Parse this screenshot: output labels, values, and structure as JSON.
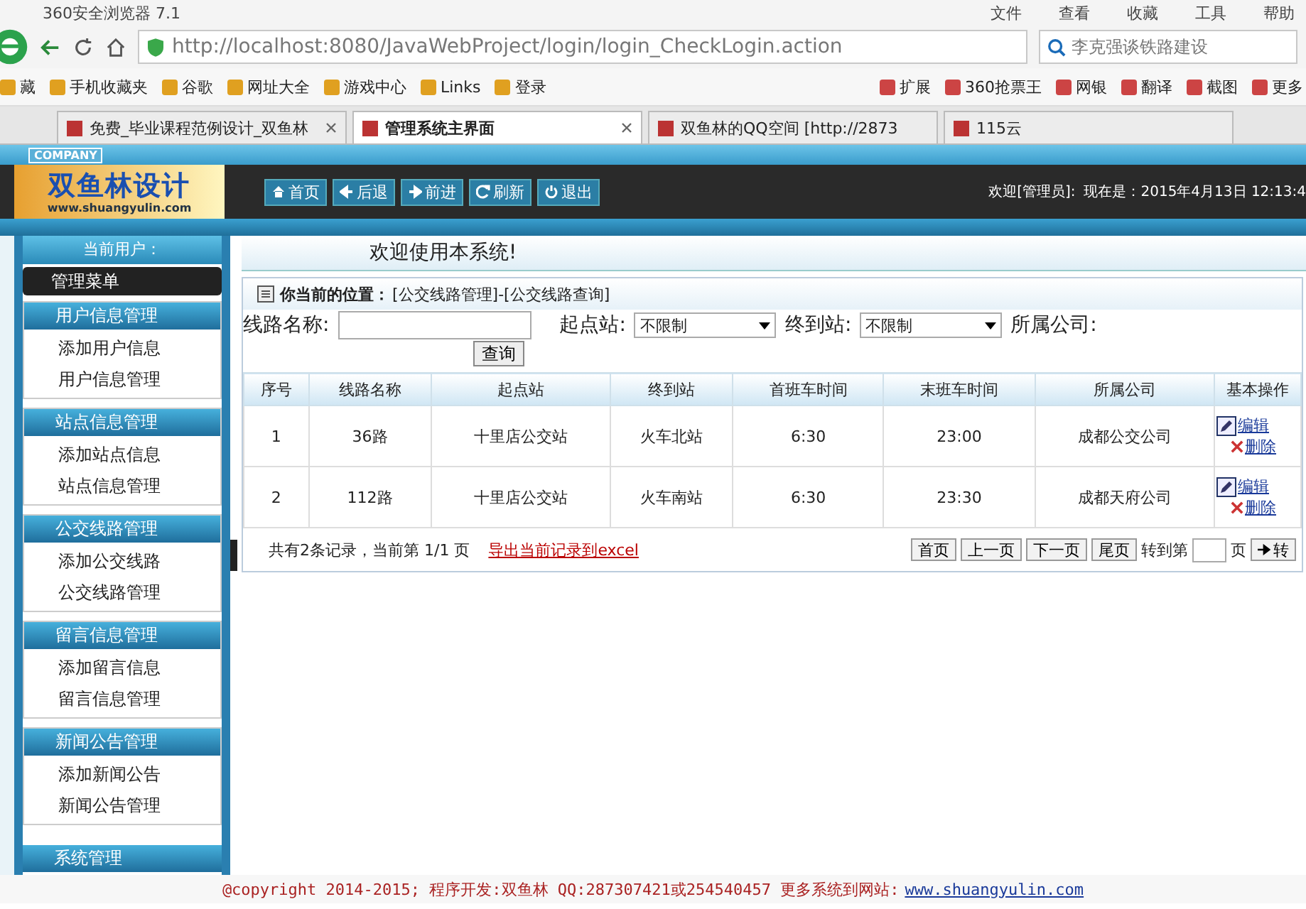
{
  "browser": {
    "title": "360安全浏览器 7.1",
    "menu": [
      "文件",
      "查看",
      "收藏",
      "工具",
      "帮助"
    ],
    "url": "http://localhost:8080/JavaWebProject/login/login_CheckLogin.action",
    "search": "李克强谈铁路建设",
    "bookmarks_left": [
      "藏",
      "手机收藏夹",
      "谷歌",
      "网址大全",
      "游戏中心",
      "Links",
      "登录"
    ],
    "bookmarks_right": [
      "扩展",
      "360抢票王",
      "网银",
      "翻译",
      "截图",
      "更多"
    ],
    "tabs": [
      {
        "label": "免费_毕业课程范例设计_双鱼林",
        "selected": false,
        "closable": true
      },
      {
        "label": "管理系统主界面",
        "selected": true,
        "closable": true
      },
      {
        "label": "双鱼林的QQ空间 [http://2873",
        "selected": false,
        "closable": false
      },
      {
        "label": "115云",
        "selected": false,
        "closable": false
      }
    ]
  },
  "header": {
    "badge": "COMPANY",
    "logo_text": "双鱼林设计",
    "logo_url": "www.shuangyulin.com",
    "nav": [
      {
        "label": "首页"
      },
      {
        "label": "后退"
      },
      {
        "label": "前进"
      },
      {
        "label": "刷新"
      },
      {
        "label": "退出"
      }
    ],
    "welcome": "欢迎[管理员]:",
    "clock": "现在是：2015年4月13日 12:13:4"
  },
  "sidebar": {
    "user_label": "当前用户：",
    "menu_title": "管理菜单",
    "groups": [
      {
        "title": "用户信息管理",
        "items": [
          "添加用户信息",
          "用户信息管理"
        ]
      },
      {
        "title": "站点信息管理",
        "items": [
          "添加站点信息",
          "站点信息管理"
        ]
      },
      {
        "title": "公交线路管理",
        "items": [
          "添加公交线路",
          "公交线路管理"
        ]
      },
      {
        "title": "留言信息管理",
        "items": [
          "添加留言信息",
          "留言信息管理"
        ]
      },
      {
        "title": "新闻公告管理",
        "items": [
          "添加新闻公告",
          "新闻公告管理"
        ]
      }
    ],
    "bottom_group": "系统管理"
  },
  "main": {
    "welcome": "欢迎使用本系统!",
    "location_label": "你当前的位置：",
    "location": "[公交线路管理]-[公交线路查询]",
    "filters": {
      "route_label": "线路名称:",
      "start_label": "起点站:",
      "start_value": "不限制",
      "end_label": "终到站:",
      "end_value": "不限制",
      "company_label": "所属公司:",
      "search_button": "查询"
    },
    "table": {
      "columns": [
        "序号",
        "线路名称",
        "起点站",
        "终到站",
        "首班车时间",
        "末班车时间",
        "所属公司",
        "基本操作"
      ],
      "rows": [
        {
          "cells": [
            "1",
            "36路",
            "十里店公交站",
            "火车北站",
            "6:30",
            "23:00",
            "成都公交公司"
          ],
          "actions": [
            "编辑",
            "删除"
          ]
        },
        {
          "cells": [
            "2",
            "112路",
            "十里店公交站",
            "火车南站",
            "6:30",
            "23:30",
            "成都天府公司"
          ],
          "actions": [
            "编辑",
            "删除"
          ]
        }
      ]
    },
    "pager": {
      "summary": "共有2条记录，当前第 1/1 页",
      "export_link": "导出当前记录到excel",
      "buttons": [
        "首页",
        "上一页",
        "下一页",
        "尾页"
      ],
      "goto_label": "转到第",
      "page_label": "页",
      "go_button": "转"
    }
  },
  "footer": {
    "text": "@copyright 2014-2015; 程序开发:双鱼林  QQ:287307421或254540457  更多系统到网站:",
    "link": "www.shuangyulin.com"
  }
}
